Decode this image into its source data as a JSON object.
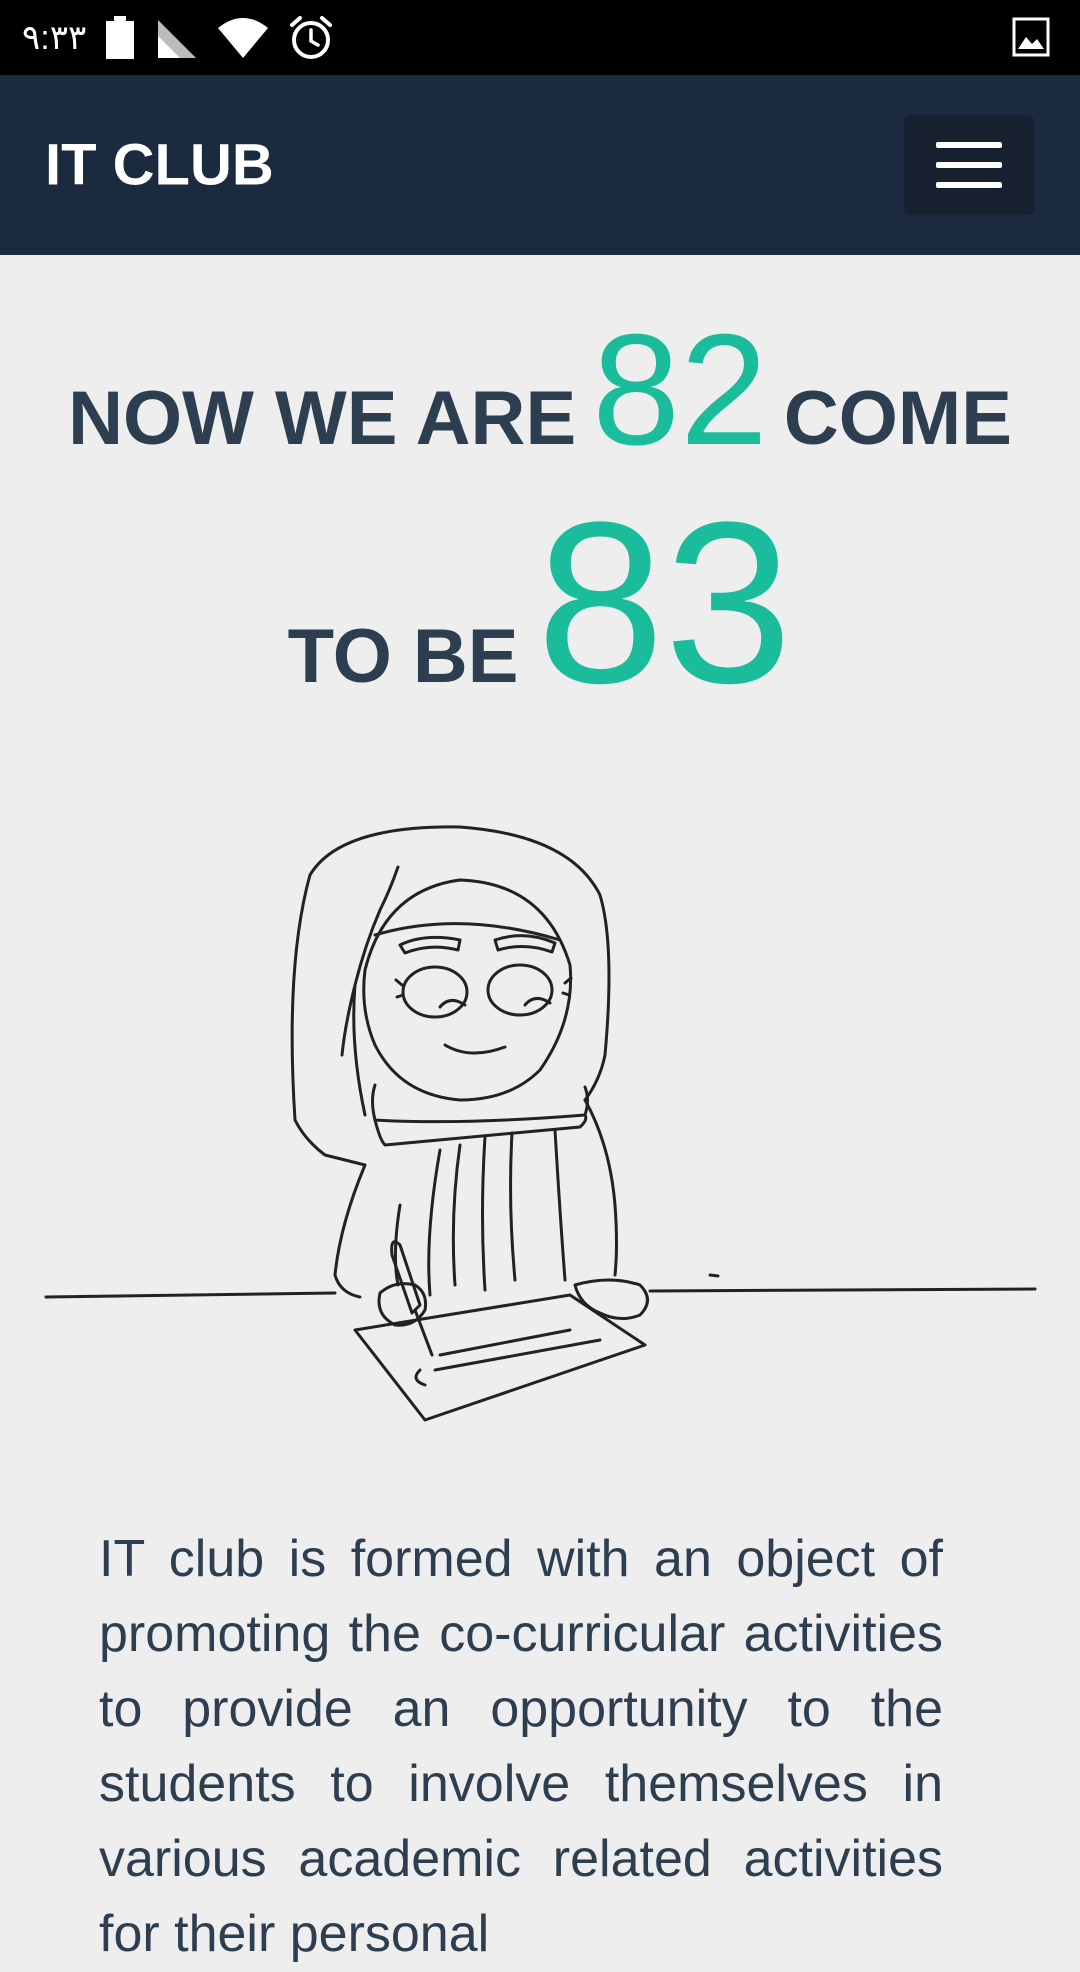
{
  "status_bar": {
    "time": "٩:٣٣",
    "icons": [
      "battery-icon",
      "signal-icon",
      "wifi-icon",
      "alarm-icon",
      "image-notification-icon"
    ]
  },
  "navbar": {
    "brand": "IT CLUB",
    "menu_icon": "hamburger-menu-icon"
  },
  "headline": {
    "prefix": "NOW WE ARE",
    "current_count": "82",
    "middle": "COME",
    "to_be": "TO BE",
    "target_count": "83"
  },
  "illustration": {
    "icon": "girl-writing-illustration"
  },
  "about": {
    "text": "IT club is formed with an object of promoting the co-curricular activities to provide an opportunity to the students to involve themselves in various academic related activities for their personal"
  },
  "colors": {
    "navbar_bg": "#1b2a3f",
    "accent": "#1abc9c",
    "text": "#2c3e50",
    "page_bg": "#eeeeee"
  }
}
